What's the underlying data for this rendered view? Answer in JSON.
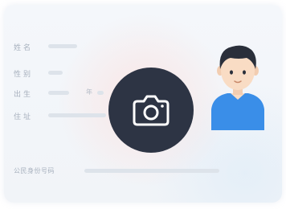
{
  "id_card": {
    "name_label": "姓名",
    "gender_label": "性别",
    "birth_label": "出生",
    "birth_year_char": "年",
    "address_label": "住址",
    "id_number_label": "公民身份号码"
  },
  "camera_button": {
    "icon": "camera-icon"
  },
  "avatar": {
    "icon": "person-avatar"
  },
  "colors": {
    "camera_bg": "#2d3444",
    "avatar_shirt": "#3a8ee8",
    "avatar_hair": "#2a2f3a",
    "avatar_skin": "#f9dcc4"
  }
}
